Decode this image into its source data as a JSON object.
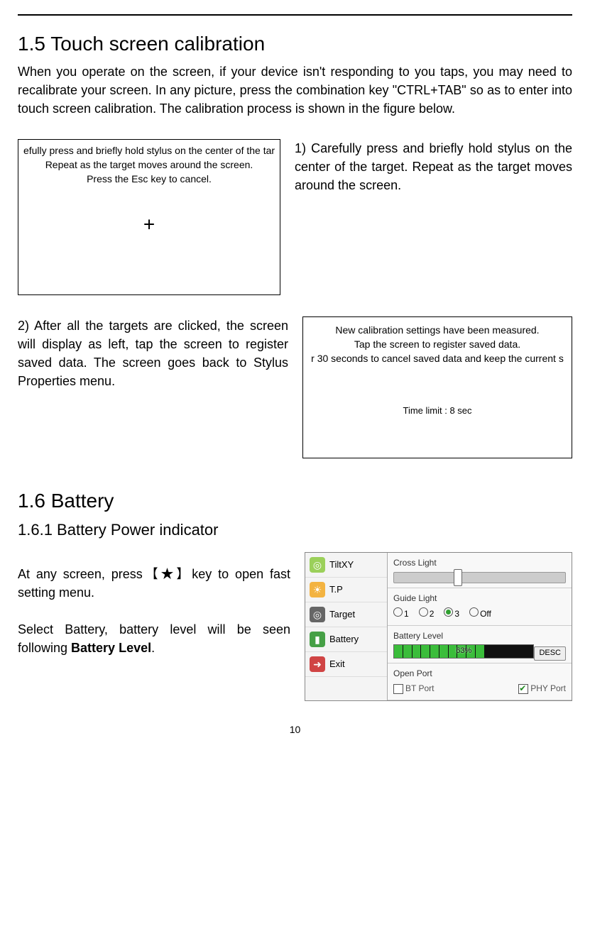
{
  "section15": {
    "heading": "1.5 Touch screen calibration",
    "intro": "When you operate on the screen, if your device isn't responding to you taps, you may need to recalibrate your screen. In any picture, press the combination key \"CTRL+TAB\" so as to enter into touch screen calibration. The calibration process is shown in the figure below.",
    "calib1_line1": "efully press and briefly hold stylus on the center of the tar",
    "calib1_line2": "Repeat as the target moves around the screen.",
    "calib1_line3": "Press the Esc key to cancel.",
    "cross": "+",
    "step1_text": "1) Carefully press and briefly hold stylus on the center of the target. Repeat as the target moves around the screen.",
    "step2_text": "2) After all the targets are clicked, the screen will display as left, tap the screen to register saved data. The screen goes back to Stylus Properties menu.",
    "calib2_line1": "New calibration settings have been measured.",
    "calib2_line2": "Tap the screen to register saved data.",
    "calib2_line3": "r 30 seconds to cancel saved data and keep the current s",
    "calib2_time": "Time limit : 8 sec"
  },
  "section16": {
    "heading": "1.6 Battery",
    "subheading": "1.6.1 Battery Power indicator",
    "body_p1": "At any screen, press【★】key to open fast setting menu.",
    "body_p2a": "Select Battery, battery level will be seen following ",
    "body_p2b_bold": "Battery Level",
    "body_p2c": "."
  },
  "fast_menu": {
    "left_items": [
      "TiltXY",
      "T.P",
      "Target",
      "Battery",
      "Exit"
    ],
    "right": {
      "cross_light": "Cross Light",
      "guide_light": "Guide Light",
      "radios": [
        "1",
        "2",
        "3",
        "Off"
      ],
      "radio_selected": 2,
      "battery_level_label": "Battery Level",
      "battery_perc": "63%",
      "desc": "DESC",
      "open_port": "Open Port",
      "bt_port": "BT Port",
      "phy_port": "PHY Port"
    }
  },
  "page_number": "10"
}
